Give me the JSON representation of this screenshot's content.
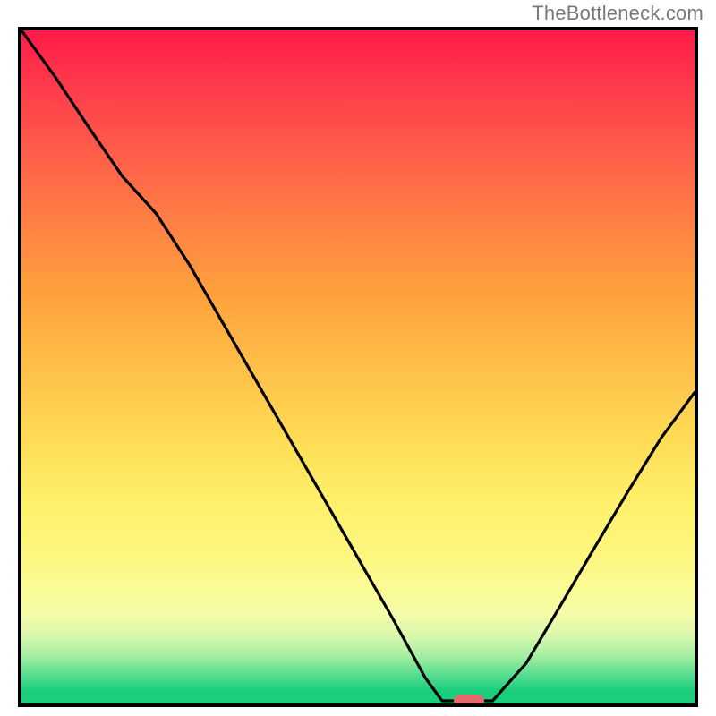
{
  "watermark": {
    "text": "TheBottleneck.com"
  },
  "chart_data": {
    "type": "line",
    "title": "",
    "xlabel": "",
    "ylabel": "",
    "x": [
      0.0,
      0.05,
      0.1,
      0.15,
      0.2,
      0.25,
      0.3,
      0.35,
      0.4,
      0.45,
      0.5,
      0.55,
      0.6,
      0.625,
      0.65,
      0.7,
      0.75,
      0.8,
      0.85,
      0.9,
      0.95,
      1.0
    ],
    "values": [
      1.0,
      0.931,
      0.856,
      0.783,
      0.728,
      0.651,
      0.564,
      0.477,
      0.39,
      0.303,
      0.216,
      0.129,
      0.038,
      0.004,
      0.004,
      0.004,
      0.06,
      0.144,
      0.229,
      0.313,
      0.394,
      0.462
    ],
    "xlim": [
      0,
      1
    ],
    "ylim": [
      0,
      1
    ],
    "grid": false,
    "legend": false,
    "marker": {
      "x": 0.665,
      "y": 0.004,
      "color": "#e26a6a"
    },
    "background_gradient": {
      "top": "#ff1a47",
      "mid": "#ffda54",
      "bottom": "#19cd7b"
    }
  }
}
